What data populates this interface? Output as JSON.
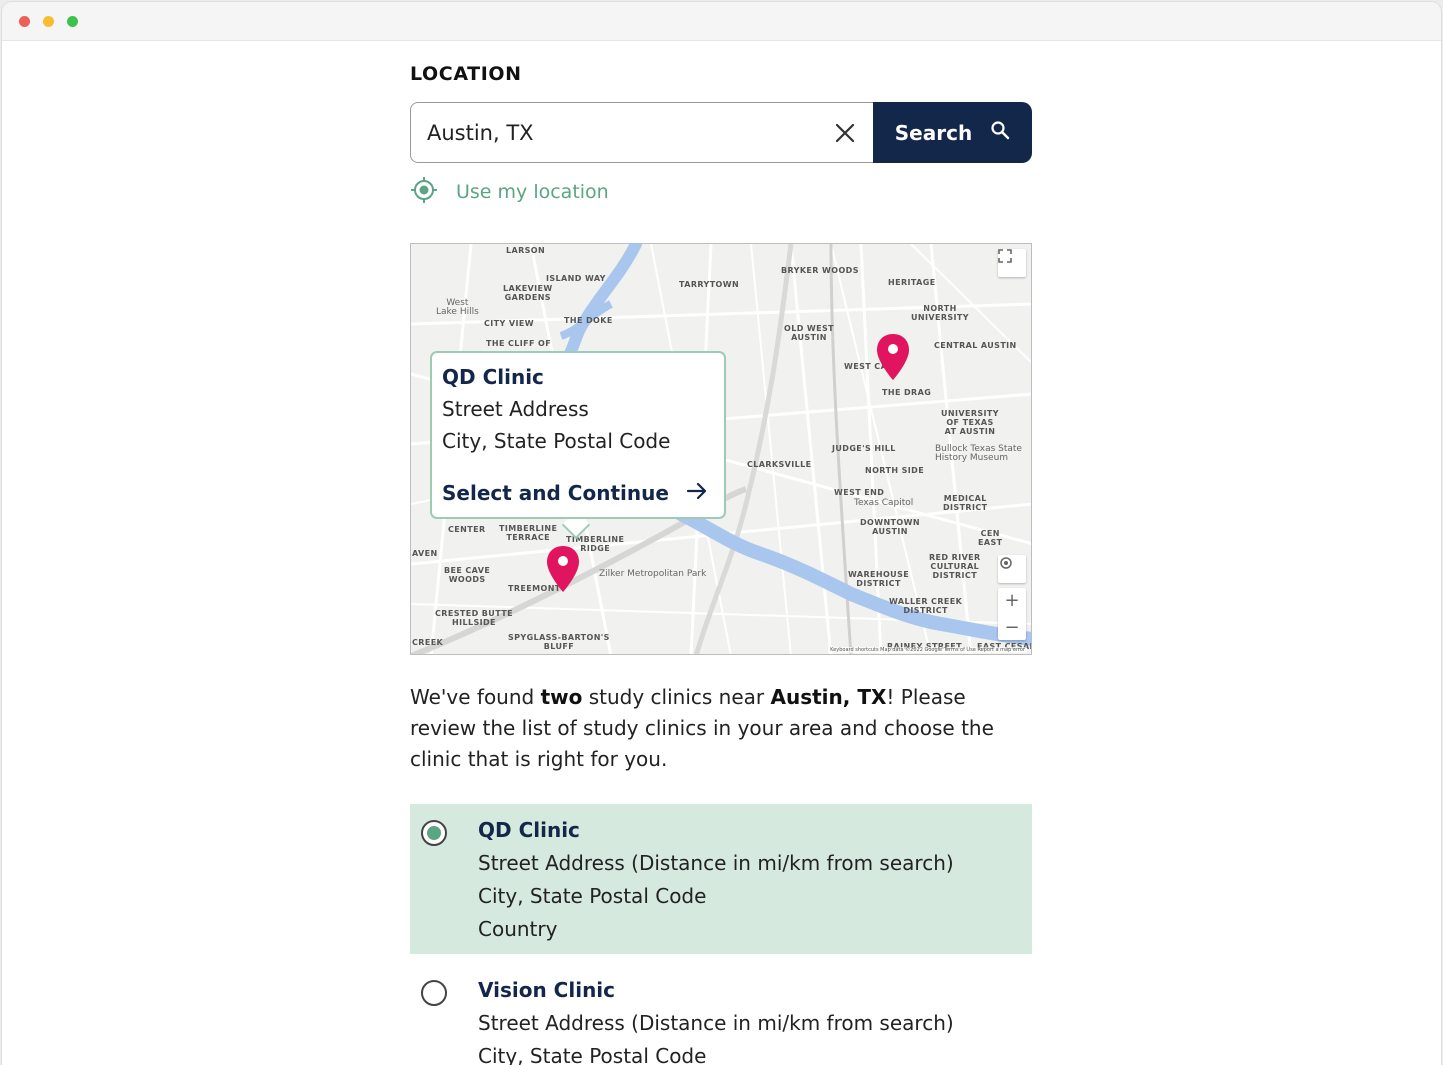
{
  "section": {
    "label": "LOCATION"
  },
  "search": {
    "value": "Austin, TX",
    "button_label": "Search",
    "use_location_label": "Use my location"
  },
  "map": {
    "labels": {
      "larson": "LARSON",
      "island_way": "ISLAND WAY",
      "lakeview_gardens": "LAKEVIEW\nGARDENS",
      "west_lake_hills": "West\nLake Hills",
      "city_view": "CITY VIEW",
      "the_doke": "THE DOKE",
      "the_cliff_of": "THE CLIFF OF",
      "tarrytown": "TARRYTOWN",
      "bryker_woods": "BRYKER WOODS",
      "heritage": "HERITAGE",
      "north_university": "NORTH\nUNIVERSITY",
      "old_west_austin": "OLD WEST\nAUSTIN",
      "central_austin": "CENTRAL AUSTIN",
      "west_campus": "WEST CA",
      "the_drag": "THE DRAG",
      "university_of_texas": "UNIVERSITY\nOF TEXAS\nAT AUSTIN",
      "judges_hill": "JUDGE'S HILL",
      "bullock_museum": "Bullock Texas State\nHistory Museum",
      "clarksville": "CLARKSVILLE",
      "north_side": "NORTH SIDE",
      "west_end": "WEST END",
      "texas_capitol": "Texas Capitol",
      "medical_district": "MEDICAL\nDISTRICT",
      "downtown_austin": "DOWNTOWN\nAUSTIN",
      "timberline_terrace": "TIMBERLINE\nTERRACE",
      "timberline_ridge": "TIMBERLINE\nRIDGE",
      "center": "CENTER",
      "bee_cave_woods": "BEE CAVE\nWOODS",
      "treemont": "TREEMONT",
      "zilker_park": "Zilker Metropolitan Park",
      "warehouse_district": "WAREHOUSE\nDISTRICT",
      "red_river": "RED RIVER\nCULTURAL\nDISTRICT",
      "waller_creek": "WALLER CREEK\nDISTRICT",
      "crested_butte": "CRESTED BUTTE\nHILLSIDE",
      "spyglass": "SPYGLASS-BARTON'S\nBLUFF",
      "rainey_street": "RAINEY STREET",
      "east_cesar": "EAST CESAI",
      "creek": "CREEK",
      "cen_east": "CEN\nEAST",
      "avenue_frag": "AVEN"
    },
    "footer": "Keyboard shortcuts   Map data ©2022 Google   Terms of Use   Report a map error",
    "pin_color": "#e0145f",
    "popup": {
      "name": "QD Clinic",
      "address": "Street Address",
      "city": "City, State Postal Code",
      "action": "Select and Continue"
    }
  },
  "results": {
    "text_before": "We've found ",
    "count_word": "two",
    "text_middle": " study clinics near ",
    "location": "Austin, TX",
    "text_after": "! Please review the list of study clinics in your area and choose the clinic that is right for you."
  },
  "clinics": [
    {
      "name": "QD Clinic",
      "address": "Street Address (Distance in mi/km from search)",
      "city": "City, State Postal Code",
      "country": "Country",
      "selected": true
    },
    {
      "name": "Vision Clinic",
      "address": "Street Address (Distance in mi/km from search)",
      "city": "City, State Postal Code",
      "selected": false
    }
  ],
  "colors": {
    "navy": "#13274a",
    "accent_green": "#5aa584",
    "selected_bg": "#d6e9df"
  }
}
